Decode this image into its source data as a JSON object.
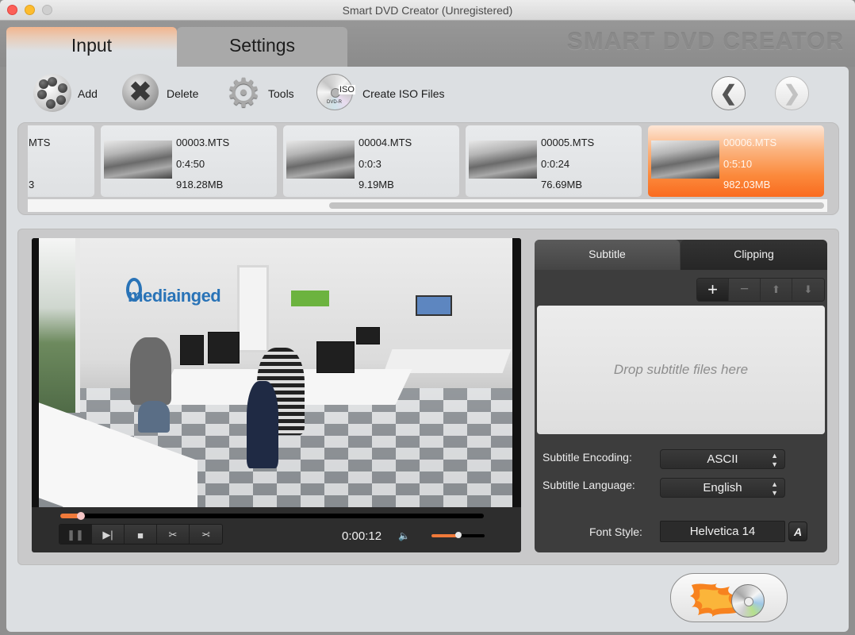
{
  "window": {
    "title": "Smart DVD Creator (Unregistered)",
    "brand_watermark": "SMART DVD CREATOR"
  },
  "main_tabs": [
    {
      "label": "Input",
      "active": true
    },
    {
      "label": "Settings",
      "active": false
    }
  ],
  "toolbar": {
    "add_label": "Add",
    "add_icon": "film-reel-icon",
    "delete_label": "Delete",
    "delete_icon": "delete-x-icon",
    "tools_label": "Tools",
    "tools_icon": "gear-icon",
    "iso_label": "Create ISO Files",
    "iso_icon": "dvd-iso-icon",
    "iso_badge": "ISO",
    "iso_disc_text": "DVD-R",
    "prev_glyph": "❮",
    "next_glyph": "❯"
  },
  "files": [
    {
      "name": "MTS",
      "duration": "",
      "size": "3",
      "selected": false,
      "partial": true
    },
    {
      "name": "00003.MTS",
      "duration": "0:4:50",
      "size": "918.28MB",
      "selected": false
    },
    {
      "name": "00004.MTS",
      "duration": "0:0:3",
      "size": "9.19MB",
      "selected": false
    },
    {
      "name": "00005.MTS",
      "duration": "0:0:24",
      "size": "76.69MB",
      "selected": false
    },
    {
      "name": "00006.MTS",
      "duration": "0:5:10",
      "size": "982.03MB",
      "selected": true
    }
  ],
  "player": {
    "logo_text": "mediainged",
    "progress_fraction": 0.04,
    "timecode": "0:00:12",
    "volume_fraction": 0.5,
    "controls": [
      {
        "name": "pause",
        "glyph": "❚❚",
        "active": true
      },
      {
        "name": "next-frame",
        "glyph": "▶|",
        "active": false
      },
      {
        "name": "stop",
        "glyph": "■",
        "active": false
      },
      {
        "name": "cut-start",
        "glyph": "✂",
        "active": false
      },
      {
        "name": "cut-end",
        "glyph": "✂",
        "active": false
      }
    ],
    "volume_glyph": "🔈"
  },
  "side_panel": {
    "tabs": [
      {
        "label": "Subtitle",
        "active": true
      },
      {
        "label": "Clipping",
        "active": false
      }
    ],
    "tools": [
      {
        "name": "add",
        "glyph": "+"
      },
      {
        "name": "remove",
        "glyph": "−"
      },
      {
        "name": "move-up",
        "glyph": "⬆"
      },
      {
        "name": "move-down",
        "glyph": "⬇"
      }
    ],
    "dropzone_text": "Drop subtitle files here",
    "encoding_label": "Subtitle Encoding:",
    "encoding_value": "ASCII",
    "language_label": "Subtitle Language:",
    "language_value": "English",
    "font_label": "Font Style:",
    "font_value": "Helvetica 14",
    "font_button_glyph": "A"
  },
  "burn_button": {
    "icon": "burn-dvd-flame-icon"
  },
  "colors": {
    "accent_orange": "#fa6b1f",
    "panel_dark": "#3d3d3d",
    "content_bg": "#dcdfe2"
  }
}
